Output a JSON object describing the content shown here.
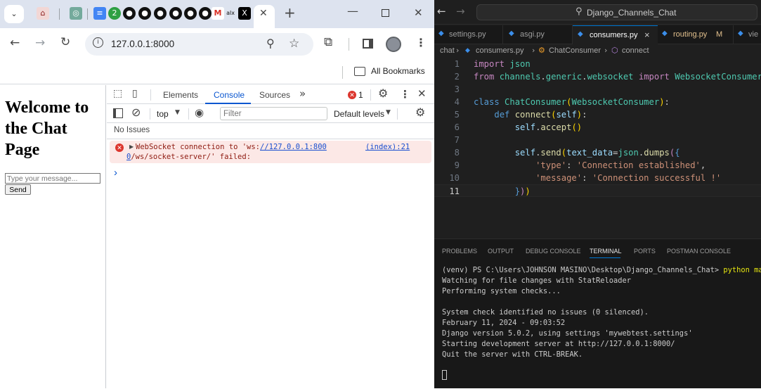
{
  "browser": {
    "tab_count_badge": "2",
    "url": "127.0.0.1:8000",
    "new_tab": "+",
    "bookmarks_label": "All Bookmarks",
    "page": {
      "heading": "Welcome to the Chat Page",
      "input_placeholder": "Type your message...",
      "send_label": "Send"
    },
    "devtools": {
      "tabs": [
        "Elements",
        "Console",
        "Sources"
      ],
      "active_tab": "Console",
      "error_count": "1",
      "context": "top",
      "filter_placeholder": "Filter",
      "levels": "Default levels",
      "no_issues": "No Issues",
      "error": {
        "pre": "WebSocket connection to 'ws:",
        "link": "//127.0.0.1:800",
        "source": "(index):21",
        "link2": "0",
        "post": "/ws/socket-server/' failed:"
      },
      "prompt": "›"
    }
  },
  "vscode": {
    "search": "Django_Channels_Chat",
    "tabs": [
      {
        "label": "settings.py",
        "status": ""
      },
      {
        "label": "asgi.py",
        "status": ""
      },
      {
        "label": "consumers.py",
        "status": "×"
      },
      {
        "label": "routing.py",
        "status": "M"
      },
      {
        "label": "vie",
        "status": ""
      }
    ],
    "breadcrumb": [
      "chat",
      "consumers.py",
      "ChatConsumer",
      "connect"
    ],
    "code_lines": [
      {
        "n": "1",
        "t": "import json"
      },
      {
        "n": "2",
        "t": "from channels.generic.websocket import WebsocketConsumer"
      },
      {
        "n": "3",
        "t": ""
      },
      {
        "n": "4",
        "t": "class ChatConsumer(WebsocketConsumer):"
      },
      {
        "n": "5",
        "t": "    def connect(self):"
      },
      {
        "n": "6",
        "t": "        self.accept()"
      },
      {
        "n": "7",
        "t": ""
      },
      {
        "n": "8",
        "t": "        self.send(text_data=json.dumps({"
      },
      {
        "n": "9",
        "t": "            'type': 'Connection established',"
      },
      {
        "n": "10",
        "t": "            'message': 'Connection successful !'"
      },
      {
        "n": "11",
        "t": "        }))"
      }
    ],
    "panel_tabs": [
      "PROBLEMS",
      "OUTPUT",
      "DEBUG CONSOLE",
      "TERMINAL",
      "PORTS",
      "POSTMAN CONSOLE"
    ],
    "active_panel": "TERMINAL",
    "terminal": {
      "prompt": "(venv) PS C:\\Users\\JOHNSON MASINO\\Desktop\\Django_Channels_Chat>",
      "command": "python manag",
      "lines": [
        "Watching for file changes with StatReloader",
        "Performing system checks...",
        "",
        "System check identified no issues (0 silenced).",
        "February 11, 2024 - 09:03:52",
        "Django version 5.0.2, using settings 'mywebtest.settings'",
        "Starting development server at http://127.0.0.1:8000/",
        "Quit the server with CTRL-BREAK."
      ]
    }
  }
}
